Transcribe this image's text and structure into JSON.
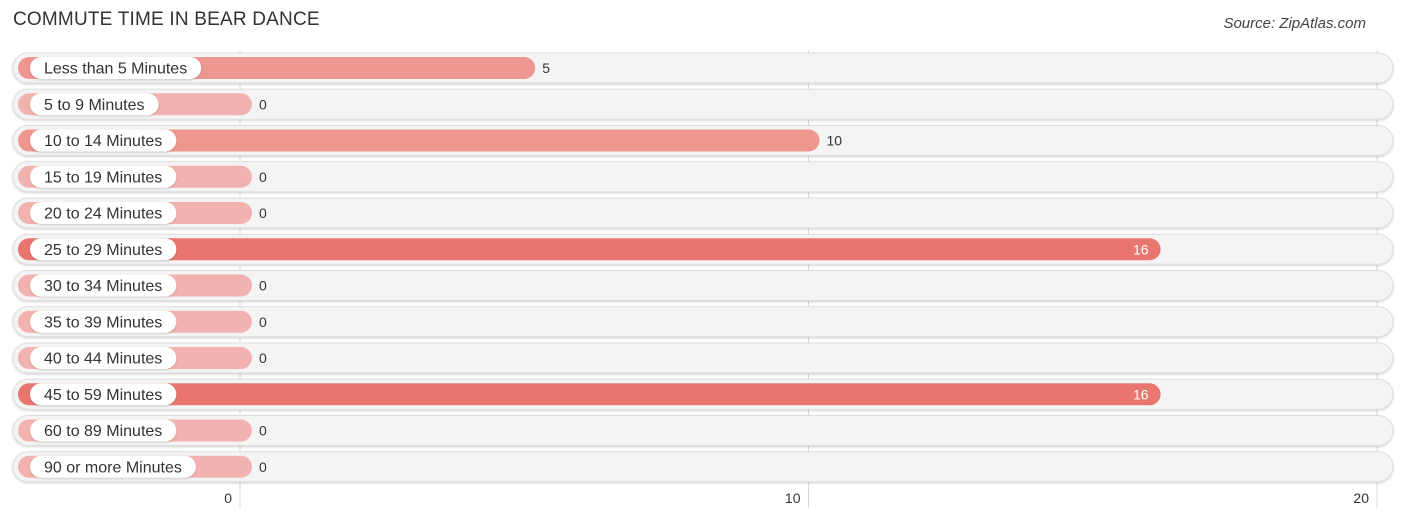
{
  "header": {
    "title": "COMMUTE TIME IN BEAR DANCE",
    "source": "Source: ZipAtlas.com"
  },
  "colors": {
    "bar_strong": "#e8766f",
    "bar_mid": "#ee9690",
    "bar_light": "#f2b3b0",
    "track": "#f4f4f4",
    "track_border": "#dddddd",
    "grid": "#d8d8d8"
  },
  "chart_data": {
    "type": "bar",
    "orientation": "horizontal",
    "title": "COMMUTE TIME IN BEAR DANCE",
    "xlabel": "",
    "ylabel": "",
    "categories": [
      "Less than 5 Minutes",
      "5 to 9 Minutes",
      "10 to 14 Minutes",
      "15 to 19 Minutes",
      "20 to 24 Minutes",
      "25 to 29 Minutes",
      "30 to 34 Minutes",
      "35 to 39 Minutes",
      "40 to 44 Minutes",
      "45 to 59 Minutes",
      "60 to 89 Minutes",
      "90 or more Minutes"
    ],
    "values": [
      5,
      0,
      10,
      0,
      0,
      16,
      0,
      0,
      0,
      16,
      0,
      0
    ],
    "xlim": [
      0,
      20
    ],
    "xticks": [
      0,
      10,
      20
    ],
    "grid": true,
    "legend": "none"
  }
}
